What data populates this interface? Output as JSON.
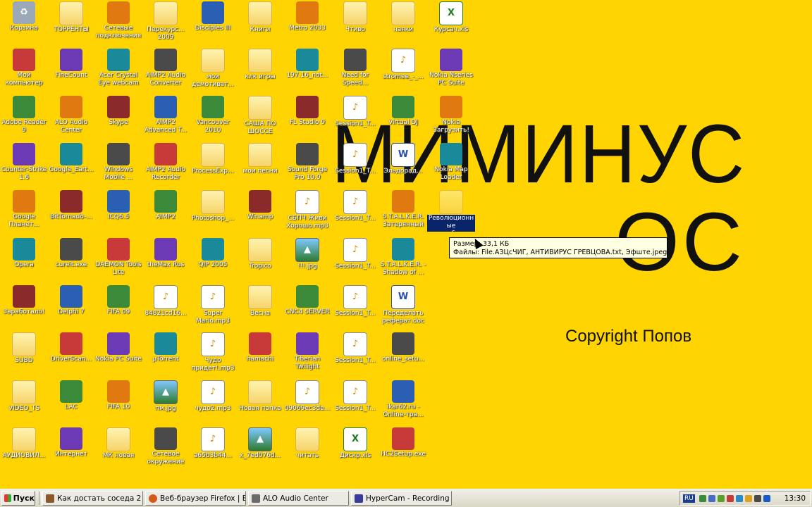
{
  "wallpaper": {
    "line1": "МИМИНУС",
    "line2": "ОС",
    "copyright": "Copyright Попов"
  },
  "icons": [
    {
      "id": "c0r0",
      "label": "Корзина",
      "kind": "trash"
    },
    {
      "id": "c0r1",
      "label": "Мой компьютер",
      "kind": "app"
    },
    {
      "id": "c0r2",
      "label": "Adobe Reader 9",
      "kind": "app"
    },
    {
      "id": "c0r3",
      "label": "Counter-Strike 1.6",
      "kind": "app"
    },
    {
      "id": "c0r4",
      "label": "Google Планет...",
      "kind": "app"
    },
    {
      "id": "c0r5",
      "label": "Opera",
      "kind": "app"
    },
    {
      "id": "c0r6",
      "label": "Заработало!",
      "kind": "app"
    },
    {
      "id": "c0r7",
      "label": "SUBD",
      "kind": "folder"
    },
    {
      "id": "c0r8",
      "label": "VIDEO_TS",
      "kind": "folder"
    },
    {
      "id": "c0r9",
      "label": "АУДИОВИЛ...",
      "kind": "folder"
    },
    {
      "id": "c1r0",
      "label": "ТОРРЕНТЫ",
      "kind": "folder"
    },
    {
      "id": "c1r1",
      "label": "FineCount",
      "kind": "app"
    },
    {
      "id": "c1r2",
      "label": "ALO Audio Center",
      "kind": "app"
    },
    {
      "id": "c1r3",
      "label": "Google_Eart...",
      "kind": "app"
    },
    {
      "id": "c1r4",
      "label": "BitTornado-...",
      "kind": "app"
    },
    {
      "id": "c1r5",
      "label": "cureit.exe",
      "kind": "app"
    },
    {
      "id": "c1r6",
      "label": "Delphi 7",
      "kind": "app"
    },
    {
      "id": "c1r7",
      "label": "DriverScan...",
      "kind": "app"
    },
    {
      "id": "c1r8",
      "label": "LAC",
      "kind": "app"
    },
    {
      "id": "c1r9",
      "label": "Интернет",
      "kind": "app"
    },
    {
      "id": "c2r0",
      "label": "Сетевые подключения",
      "kind": "app"
    },
    {
      "id": "c2r1",
      "label": "Acer Crystal Eye webcam",
      "kind": "app"
    },
    {
      "id": "c2r2",
      "label": "Skype",
      "kind": "app"
    },
    {
      "id": "c2r3",
      "label": "Windows Mobile ...",
      "kind": "app"
    },
    {
      "id": "c2r4",
      "label": "ICQ6.5",
      "kind": "app"
    },
    {
      "id": "c2r5",
      "label": "DAEMON Tools Lite",
      "kind": "app"
    },
    {
      "id": "c2r6",
      "label": "FIFA 09",
      "kind": "app"
    },
    {
      "id": "c2r7",
      "label": "Nokia PC Suite",
      "kind": "app"
    },
    {
      "id": "c2r8",
      "label": "FIFA 10",
      "kind": "app"
    },
    {
      "id": "c2r9",
      "label": "МК новая",
      "kind": "folder"
    },
    {
      "id": "c3r0",
      "label": "Перекурс... 2009",
      "kind": "folder"
    },
    {
      "id": "c3r1",
      "label": "AIMP2 Audio Converter",
      "kind": "app"
    },
    {
      "id": "c3r2",
      "label": "AIMP2 Advanced T...",
      "kind": "app"
    },
    {
      "id": "c3r3",
      "label": "AIMP2 Audio Recorder",
      "kind": "app"
    },
    {
      "id": "c3r4",
      "label": "AIMP2",
      "kind": "app"
    },
    {
      "id": "c3r5",
      "label": "theMax Rus",
      "kind": "app"
    },
    {
      "id": "c3r6",
      "label": "84821cd16...",
      "kind": "doc"
    },
    {
      "id": "c3r7",
      "label": "µTorrent",
      "kind": "app"
    },
    {
      "id": "c3r8",
      "label": "пм.jpg",
      "kind": "img"
    },
    {
      "id": "c3r9",
      "label": "Сетевое окружение",
      "kind": "app"
    },
    {
      "id": "c4r0",
      "label": "Disciples III",
      "kind": "app"
    },
    {
      "id": "c4r1",
      "label": "мои демотиват...",
      "kind": "folder"
    },
    {
      "id": "c4r2",
      "label": "Vancouver 2010",
      "kind": "app"
    },
    {
      "id": "c4r3",
      "label": "ProcessExp...",
      "kind": "folder"
    },
    {
      "id": "c4r4",
      "label": "Photoshop_...",
      "kind": "folder"
    },
    {
      "id": "c4r5",
      "label": "QIP 2005",
      "kind": "app"
    },
    {
      "id": "c4r6",
      "label": "Super Mario.mp3",
      "kind": "doc"
    },
    {
      "id": "c4r7",
      "label": "Чудо придет!.mp3",
      "kind": "doc"
    },
    {
      "id": "c4r8",
      "label": "чудо2.mp3",
      "kind": "doc"
    },
    {
      "id": "c4r9",
      "label": "a65b3b44...",
      "kind": "doc"
    },
    {
      "id": "c5r0",
      "label": "Книги",
      "kind": "folder"
    },
    {
      "id": "c5r1",
      "label": "клк игры",
      "kind": "folder"
    },
    {
      "id": "c5r2",
      "label": "САША ПО ШОССЕ",
      "kind": "folder"
    },
    {
      "id": "c5r3",
      "label": "мои песни",
      "kind": "folder"
    },
    {
      "id": "c5r4",
      "label": "Winamp",
      "kind": "app"
    },
    {
      "id": "c5r5",
      "label": "Tropico",
      "kind": "folder"
    },
    {
      "id": "c5r6",
      "label": "Весна",
      "kind": "folder"
    },
    {
      "id": "c5r7",
      "label": "hamachi",
      "kind": "app"
    },
    {
      "id": "c5r8",
      "label": "Новая папка",
      "kind": "folder"
    },
    {
      "id": "c5r9",
      "label": "x_7ed076d...",
      "kind": "img"
    },
    {
      "id": "c6r0",
      "label": "Metro 2033",
      "kind": "app"
    },
    {
      "id": "c6r1",
      "label": "197.16_not...",
      "kind": "app"
    },
    {
      "id": "c6r2",
      "label": "FL Studio 9",
      "kind": "app"
    },
    {
      "id": "c6r3",
      "label": "Sound Forge Pro 10.0",
      "kind": "app"
    },
    {
      "id": "c6r4",
      "label": "СБПЧ Живи Хорошо.mp3",
      "kind": "doc"
    },
    {
      "id": "c6r5",
      "label": "!!!.jpg",
      "kind": "img"
    },
    {
      "id": "c6r6",
      "label": "CNC4 SERVER",
      "kind": "app"
    },
    {
      "id": "c6r7",
      "label": "Tiberian Twilight",
      "kind": "app"
    },
    {
      "id": "c6r8",
      "label": "09069ec3da...",
      "kind": "doc"
    },
    {
      "id": "c6r9",
      "label": "читать",
      "kind": "folder"
    },
    {
      "id": "c7r0",
      "label": "Чтиво",
      "kind": "folder"
    },
    {
      "id": "c7r1",
      "label": "Need for Speed...",
      "kind": "app"
    },
    {
      "id": "c7r2",
      "label": "Session1_T...",
      "kind": "doc"
    },
    {
      "id": "c7r3",
      "label": "Session1_T...",
      "kind": "doc"
    },
    {
      "id": "c7r4",
      "label": "Session1_T...",
      "kind": "doc"
    },
    {
      "id": "c7r5",
      "label": "Session1_T...",
      "kind": "doc"
    },
    {
      "id": "c7r6",
      "label": "Session1_T...",
      "kind": "doc"
    },
    {
      "id": "c7r7",
      "label": "Session1_T...",
      "kind": "doc"
    },
    {
      "id": "c7r8",
      "label": "Session1_T...",
      "kind": "doc"
    },
    {
      "id": "c7r9",
      "label": "Дискр.xls",
      "kind": "xls"
    },
    {
      "id": "c8r0",
      "label": "наяки",
      "kind": "folder"
    },
    {
      "id": "c8r1",
      "label": "stromee_-_...",
      "kind": "doc"
    },
    {
      "id": "c8r2",
      "label": "Virtual DJ",
      "kind": "app"
    },
    {
      "id": "c8r3",
      "label": "Эльдорад...",
      "kind": "word"
    },
    {
      "id": "c8r4",
      "label": "S.T.A.L.K.E.R. Затерянный ...",
      "kind": "app"
    },
    {
      "id": "c8r5",
      "label": "S.T.A.L.K.E.R. - Shadow of ...",
      "kind": "app"
    },
    {
      "id": "c8r6",
      "label": "Переделать реферат.doc",
      "kind": "word"
    },
    {
      "id": "c8r7",
      "label": "online_setu...",
      "kind": "app"
    },
    {
      "id": "c8r8",
      "label": "ikar62.ru - Online-тра...",
      "kind": "app"
    },
    {
      "id": "c8r9",
      "label": "HC2Setup.exe",
      "kind": "app"
    },
    {
      "id": "c9r0",
      "label": "Курсач.xls",
      "kind": "xls"
    },
    {
      "id": "c9r1",
      "label": "Nokia Nseries PC Suite",
      "kind": "app"
    },
    {
      "id": "c9r2",
      "label": "Nokia Загрузить!",
      "kind": "app"
    },
    {
      "id": "c9r3",
      "label": "Nokia Map Loader",
      "kind": "app"
    },
    {
      "id": "c9r4",
      "label": "Революционные дистрибутив...",
      "kind": "folder",
      "selected": true
    }
  ],
  "tooltip": {
    "line1": "Размер: 33,1 КБ",
    "line2": "Файлы: File.АЗЦсЧИГ, АНТИВИРУС ГРЕВЦОВА.txt, Эфште.jpeg, ..."
  },
  "taskbar": {
    "start_label": "Пуск",
    "tasks": [
      {
        "label": "Как достать соседа 2"
      },
      {
        "label": "Веб-браузер Firefox | Б..."
      },
      {
        "label": "ALO Audio Center"
      },
      {
        "label": "HyperCam - Recording"
      }
    ],
    "language": "RU",
    "clock": "13:30"
  },
  "colors": {
    "background": "#ffd400",
    "selection": "#0a246a",
    "tooltip": "#ffffe1"
  }
}
